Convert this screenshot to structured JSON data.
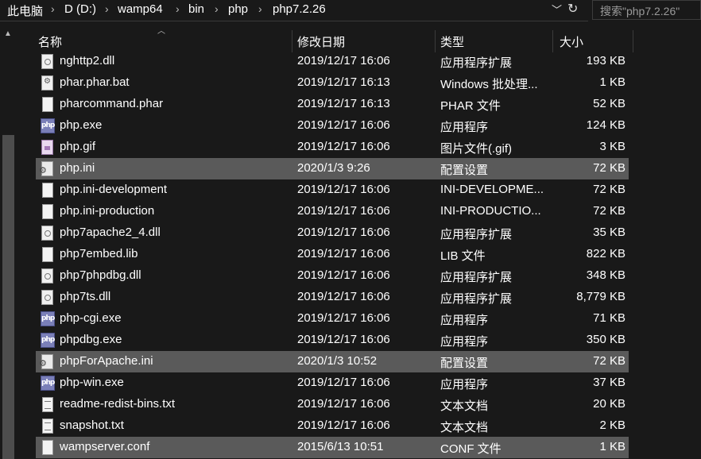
{
  "breadcrumb": [
    "此电脑",
    "D (D:)",
    "wamp64",
    "bin",
    "php",
    "php7.2.26"
  ],
  "search": {
    "placeholder": "搜索\"php7.2.26\""
  },
  "columns": {
    "name": "名称",
    "date": "修改日期",
    "type": "类型",
    "size": "大小"
  },
  "icons": {
    "dropdown": "chevron-down-icon",
    "refresh": "refresh-icon",
    "sort": "sort-up-icon"
  },
  "files": [
    {
      "name": "nghttp2.dll",
      "date": "2019/12/17 16:06",
      "type": "应用程序扩展",
      "size": "193 KB",
      "icon": "dll",
      "selected": false
    },
    {
      "name": "phar.phar.bat",
      "date": "2019/12/17 16:13",
      "type": "Windows 批处理...",
      "size": "1 KB",
      "icon": "bat",
      "selected": false
    },
    {
      "name": "pharcommand.phar",
      "date": "2019/12/17 16:13",
      "type": "PHAR 文件",
      "size": "52 KB",
      "icon": "file",
      "selected": false
    },
    {
      "name": "php.exe",
      "date": "2019/12/17 16:06",
      "type": "应用程序",
      "size": "124 KB",
      "icon": "php",
      "selected": false
    },
    {
      "name": "php.gif",
      "date": "2019/12/17 16:06",
      "type": "图片文件(.gif)",
      "size": "3 KB",
      "icon": "gif",
      "selected": false
    },
    {
      "name": "php.ini",
      "date": "2020/1/3 9:26",
      "type": "配置设置",
      "size": "72 KB",
      "icon": "ini",
      "selected": true
    },
    {
      "name": "php.ini-development",
      "date": "2019/12/17 16:06",
      "type": "INI-DEVELOPME...",
      "size": "72 KB",
      "icon": "file",
      "selected": false
    },
    {
      "name": "php.ini-production",
      "date": "2019/12/17 16:06",
      "type": "INI-PRODUCTIO...",
      "size": "72 KB",
      "icon": "file",
      "selected": false
    },
    {
      "name": "php7apache2_4.dll",
      "date": "2019/12/17 16:06",
      "type": "应用程序扩展",
      "size": "35 KB",
      "icon": "dll",
      "selected": false
    },
    {
      "name": "php7embed.lib",
      "date": "2019/12/17 16:06",
      "type": "LIB 文件",
      "size": "822 KB",
      "icon": "file",
      "selected": false
    },
    {
      "name": "php7phpdbg.dll",
      "date": "2019/12/17 16:06",
      "type": "应用程序扩展",
      "size": "348 KB",
      "icon": "dll",
      "selected": false
    },
    {
      "name": "php7ts.dll",
      "date": "2019/12/17 16:06",
      "type": "应用程序扩展",
      "size": "8,779 KB",
      "icon": "dll",
      "selected": false
    },
    {
      "name": "php-cgi.exe",
      "date": "2019/12/17 16:06",
      "type": "应用程序",
      "size": "71 KB",
      "icon": "php",
      "selected": false
    },
    {
      "name": "phpdbg.exe",
      "date": "2019/12/17 16:06",
      "type": "应用程序",
      "size": "350 KB",
      "icon": "php",
      "selected": false
    },
    {
      "name": "phpForApache.ini",
      "date": "2020/1/3 10:52",
      "type": "配置设置",
      "size": "72 KB",
      "icon": "ini",
      "selected": true
    },
    {
      "name": "php-win.exe",
      "date": "2019/12/17 16:06",
      "type": "应用程序",
      "size": "37 KB",
      "icon": "php",
      "selected": false
    },
    {
      "name": "readme-redist-bins.txt",
      "date": "2019/12/17 16:06",
      "type": "文本文档",
      "size": "20 KB",
      "icon": "txt",
      "selected": false
    },
    {
      "name": "snapshot.txt",
      "date": "2019/12/17 16:06",
      "type": "文本文档",
      "size": "2 KB",
      "icon": "txt",
      "selected": false
    },
    {
      "name": "wampserver.conf",
      "date": "2015/6/13 10:51",
      "type": "CONF 文件",
      "size": "1 KB",
      "icon": "file",
      "selected": true
    }
  ]
}
